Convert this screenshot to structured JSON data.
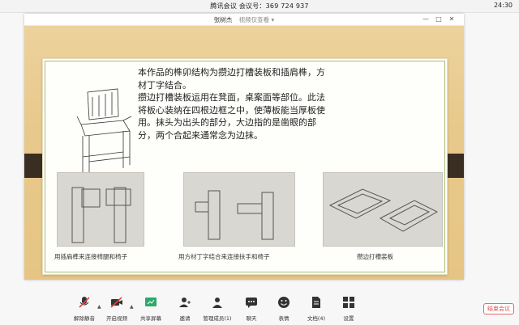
{
  "topbar": {
    "title": "腾讯会议  会议号：369 724 937",
    "time": "24:30"
  },
  "share": {
    "sharer": "张树杰",
    "view_menu": "视频仅查看 ▾",
    "controls": [
      "—",
      "□",
      "✕"
    ]
  },
  "slide": {
    "paragraphs": [
      "本作品的榫卯结构为攒边打槽装板和插肩榫，方材丁字结合。",
      "攒边打槽装板运用在凳面，桌案面等部位。此法将板心装纳在四根边框之中，使薄板能当厚板使用。抹头为出头的部分，大边指的是凿眼的部分，两个合起来通常念为边抹。"
    ],
    "captions": [
      "用插肩榫来连接椅腿和椅子",
      "用方材丁字结合来连接扶手和椅子",
      "攒边打槽装板"
    ]
  },
  "toolbar": {
    "items": [
      {
        "label": "解除静音"
      },
      {
        "label": "开启视频"
      },
      {
        "label": "共享屏幕"
      },
      {
        "label": "邀请"
      },
      {
        "label": "管理成员(1)"
      },
      {
        "label": "聊天"
      },
      {
        "label": "表情"
      },
      {
        "label": "文档(4)"
      },
      {
        "label": "设置"
      }
    ],
    "end_label": "结束会议"
  },
  "colors": {
    "accent_green": "#2fa86b",
    "end_red": "#d9534f",
    "frame_brown": "#3a2d22"
  }
}
